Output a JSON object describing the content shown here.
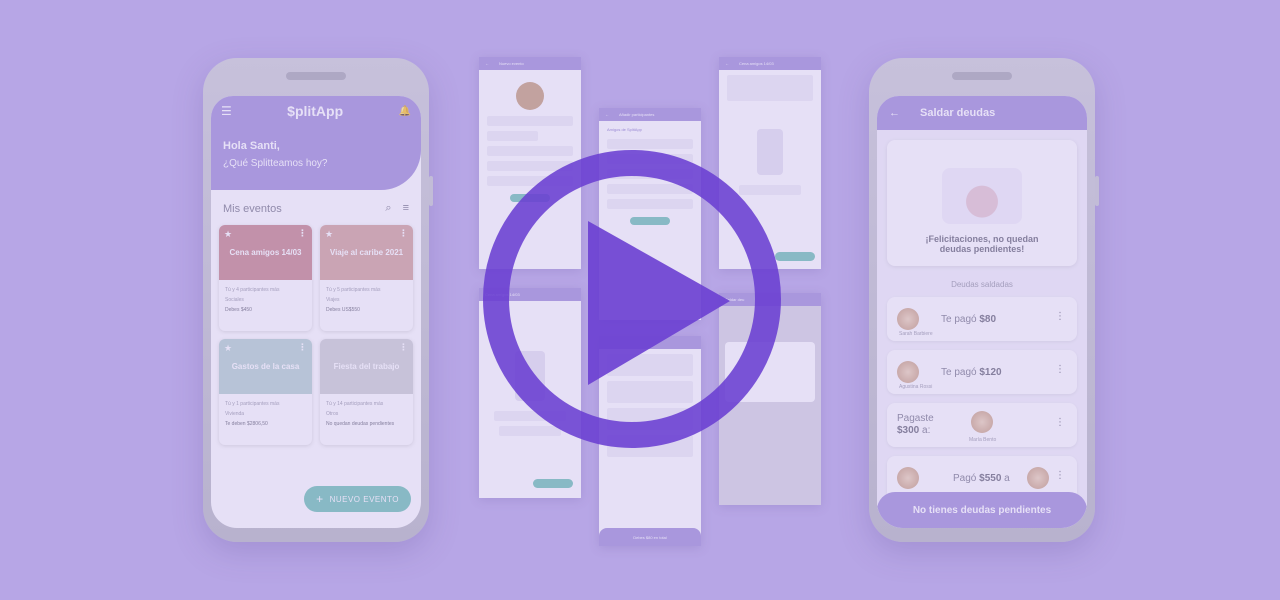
{
  "left_phone": {
    "app_title": "$plitApp",
    "greeting": "Hola Santi,",
    "question": "¿Qué Splitteamos hoy?",
    "section_title": "Mis eventos",
    "events": [
      {
        "title": "Cena amigos 14/03",
        "participants": "Tú y 4 participantes más",
        "category": "Sociales",
        "balance": "Debes $450",
        "color": "#c8868a"
      },
      {
        "title": "Viaje al caribe 2021",
        "participants": "Tú y 5 participantes más",
        "category": "Viajes",
        "balance": "Debes US$550",
        "color": "#d5a39a"
      },
      {
        "title": "Gastos de la casa",
        "participants": "Tú y 1 participantes más",
        "category": "Vivienda",
        "balance": "Te deben $2806,50",
        "color": "#b7d3cf"
      },
      {
        "title": "Fiesta del trabajo",
        "participants": "Tú y 14 participantes más",
        "category": "Otros",
        "balance": "No quedan deudas pendientes",
        "color": "#cfd1d3"
      }
    ],
    "fab_label": "NUEVO EVENTO"
  },
  "right_phone": {
    "title": "Saldar deudas",
    "congrats": "¡Felicitaciones, no quedan deudas pendientes!",
    "settled_label": "Deudas saldadas",
    "debts": [
      {
        "text": "Te pagó",
        "amount": "$80",
        "name": "Sarah Barbiere"
      },
      {
        "text": "Te pagó",
        "amount": "$120",
        "name": "Agustina Rossi"
      },
      {
        "text": "Pagaste",
        "amount": "$300",
        "suffix": "a:",
        "name": "María Bento"
      },
      {
        "text": "Pagó",
        "amount": "$550",
        "suffix": "a",
        "name": ""
      }
    ],
    "banner": "No tienes deudas pendientes"
  },
  "mockups": {
    "mock1_title": "Nuevo evento",
    "mock2_title": "Añadir participantes",
    "mock2_subtitle": "Amigos de SplitApp",
    "mock3_title": "Cena amigos 14/03",
    "mock4_title": "Cena amigos 14/03",
    "mock5_footer": "Debes $80 en total",
    "mock6_title": "Saldar deu"
  },
  "colors": {
    "background": "#b7a6e6",
    "primary": "#a18fd9",
    "accent": "#6fc3b4",
    "play": "#6a3fd1"
  }
}
